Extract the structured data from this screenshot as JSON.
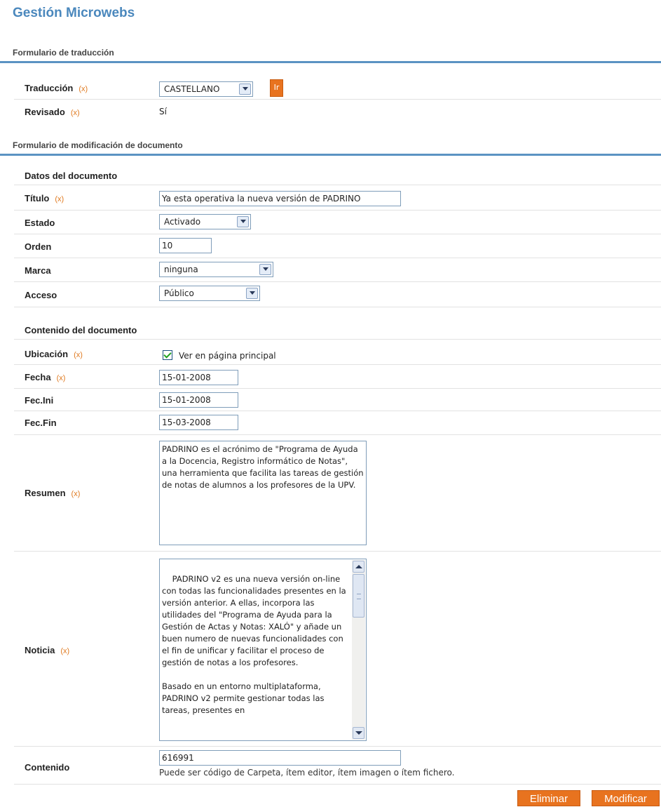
{
  "page_title": "Gestión Microwebs",
  "required_marker": "(x)",
  "translation_form": {
    "header": "Formulario de traducción",
    "translation_label": "Traducción",
    "translation_value": "CASTELLANO",
    "go_button": "Ir",
    "reviewed_label": "Revisado",
    "reviewed_value": "Sí"
  },
  "document_form": {
    "header": "Formulario de modificación de documento",
    "data_group": "Datos del documento",
    "title_label": "Título",
    "title_value": "Ya esta operativa la nueva versión de PADRINO",
    "state_label": "Estado",
    "state_value": "Activado",
    "order_label": "Orden",
    "order_value": "10",
    "mark_label": "Marca",
    "mark_value": "ninguna",
    "access_label": "Acceso",
    "access_value": "Público",
    "content_group": "Contenido del documento",
    "location_label": "Ubicación",
    "location_checkbox_label": "Ver en página principal",
    "date_label": "Fecha",
    "date_value": "15-01-2008",
    "start_label": "Fec.Ini",
    "start_value": "15-01-2008",
    "end_label": "Fec.Fin",
    "end_value": "15-03-2008",
    "summary_label": "Resumen",
    "summary_value": "PADRINO es el acrónimo de \"Programa de Ayuda a la Docencia, Registro informático de Notas\", una herramienta que facilita las tareas de gestión de notas de alumnos a los profesores de la UPV.",
    "news_label": "Noticia",
    "news_value": "PADRINO v2 es una nueva versión on-line con todas las funcionalidades presentes en la versión anterior. A ellas, incorpora las utilidades del \"Programa de Ayuda para la Gestión de Actas y Notas: XALÓ\" y añade un buen numero de nuevas funcionalidades con el fin de unificar y facilitar el proceso de gestión de notas a los profesores.\n\nBasado en un entorno multiplataforma, PADRINO v2 permite gestionar todas las tareas, presentes en",
    "content_label": "Contenido",
    "content_value": "616991",
    "content_hint": "Puede ser código de Carpeta, ítem editor, ítem imagen o ítem fichero."
  },
  "actions": {
    "delete": "Eliminar",
    "modify": "Modificar"
  },
  "colors": {
    "title_blue": "#4b88bd",
    "header_rule": "#5b93c3",
    "accent_orange": "#e8731f"
  }
}
